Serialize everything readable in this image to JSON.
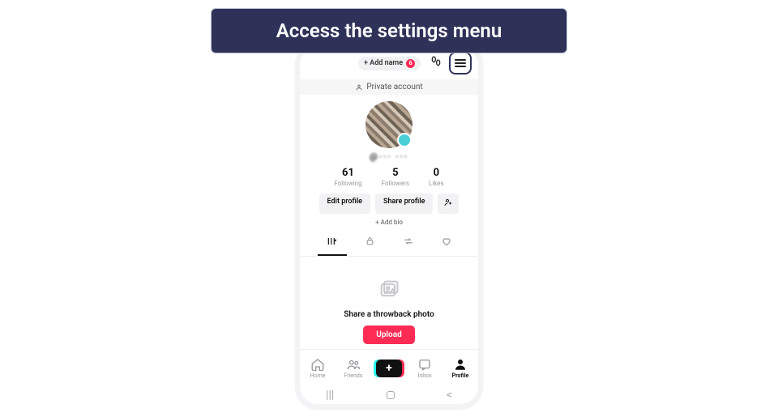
{
  "banner": {
    "text": "Access the settings menu"
  },
  "topbar": {
    "add_name_label": "+ Add name",
    "add_name_badge": "6"
  },
  "private_account": {
    "label": "Private account"
  },
  "username": "@··· ···",
  "stats": {
    "following": {
      "value": "61",
      "label": "Following"
    },
    "followers": {
      "value": "5",
      "label": "Followers"
    },
    "likes": {
      "value": "0",
      "label": "Likes"
    }
  },
  "buttons": {
    "edit_profile": "Edit profile",
    "share_profile": "Share profile",
    "add_bio": "+ Add bio"
  },
  "empty_state": {
    "title": "Share a throwback photo",
    "upload": "Upload"
  },
  "nav": {
    "home": "Home",
    "friends": "Friends",
    "create": "+",
    "inbox": "Inbox",
    "profile": "Profile"
  }
}
